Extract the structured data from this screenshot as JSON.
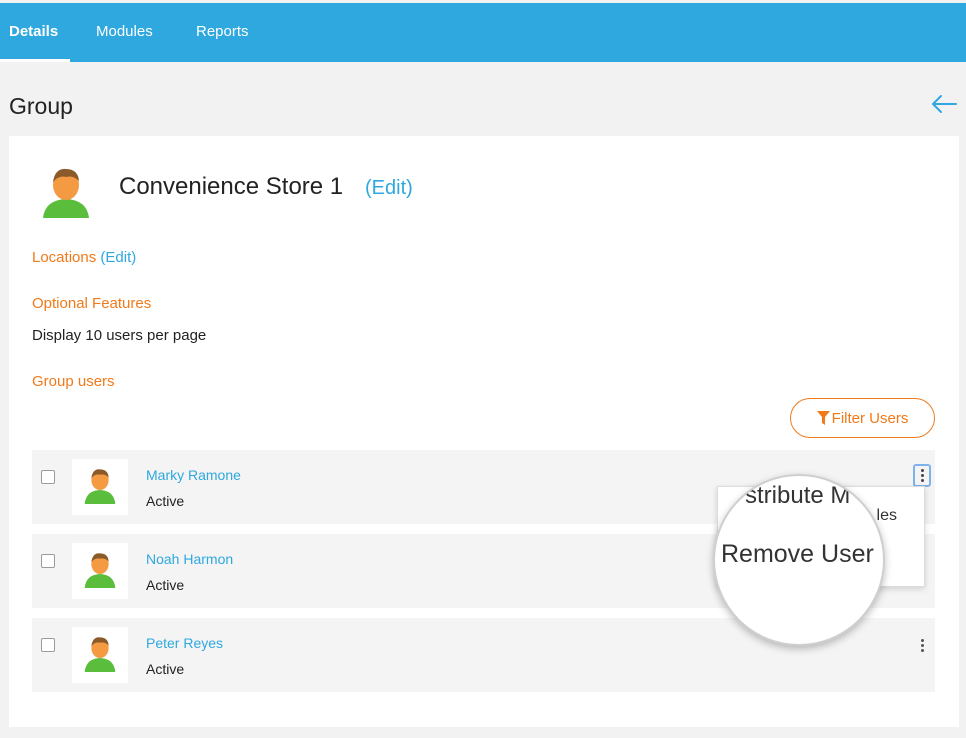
{
  "tabs": {
    "details": "Details",
    "modules": "Modules",
    "reports": "Reports"
  },
  "page_title": "Group",
  "group": {
    "name": "Convenience Store 1",
    "edit_label": "(Edit)"
  },
  "locations": {
    "label": "Locations",
    "edit_label": "(Edit)"
  },
  "optional_features": {
    "label": "Optional Features",
    "per_page_text": "Display 10 users per page"
  },
  "group_users": {
    "label": "Group users",
    "filter_button": "Filter Users"
  },
  "users": [
    {
      "name": "Marky Ramone",
      "status": "Active"
    },
    {
      "name": "Noah Harmon",
      "status": "Active"
    },
    {
      "name": "Peter Reyes",
      "status": "Active"
    }
  ],
  "context_menu": {
    "item_1_partial": "les",
    "magnified_top": "stribute M",
    "remove_user": "Remove User"
  },
  "colors": {
    "accent_blue": "#2ea8df",
    "accent_orange": "#f07a1a"
  }
}
